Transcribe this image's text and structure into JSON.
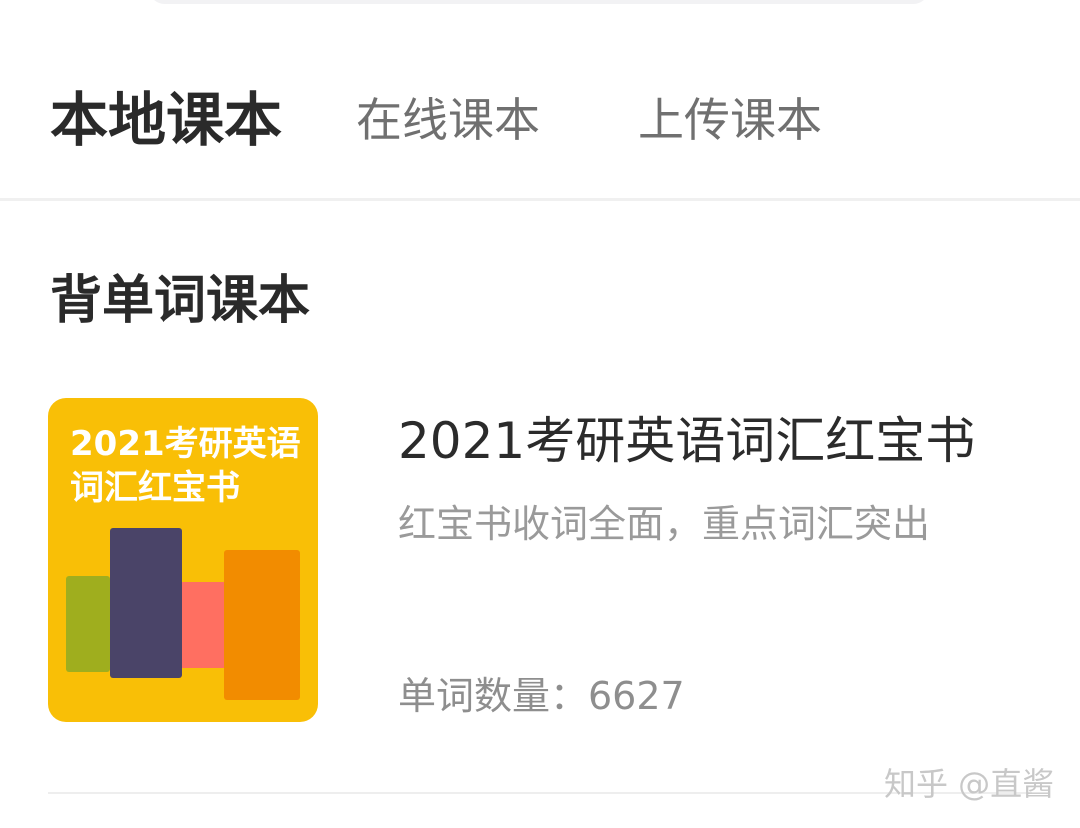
{
  "tabs": {
    "local": "本地课本",
    "online": "在线课本",
    "upload": "上传课本"
  },
  "section": {
    "title": "背单词课本"
  },
  "book": {
    "cover_title": "2021考研英语词汇红宝书",
    "title": "2021考研英语词汇红宝书",
    "description": "红宝书收词全面，重点词汇突出",
    "word_count": "单词数量：6627"
  },
  "watermark": "知乎 @直酱",
  "colors": {
    "cover_background": "#f9bf06",
    "bar_green": "#9fae1e",
    "bar_purple": "#4a4468",
    "bar_red": "#ff6f61",
    "bar_orange": "#f28c00"
  }
}
